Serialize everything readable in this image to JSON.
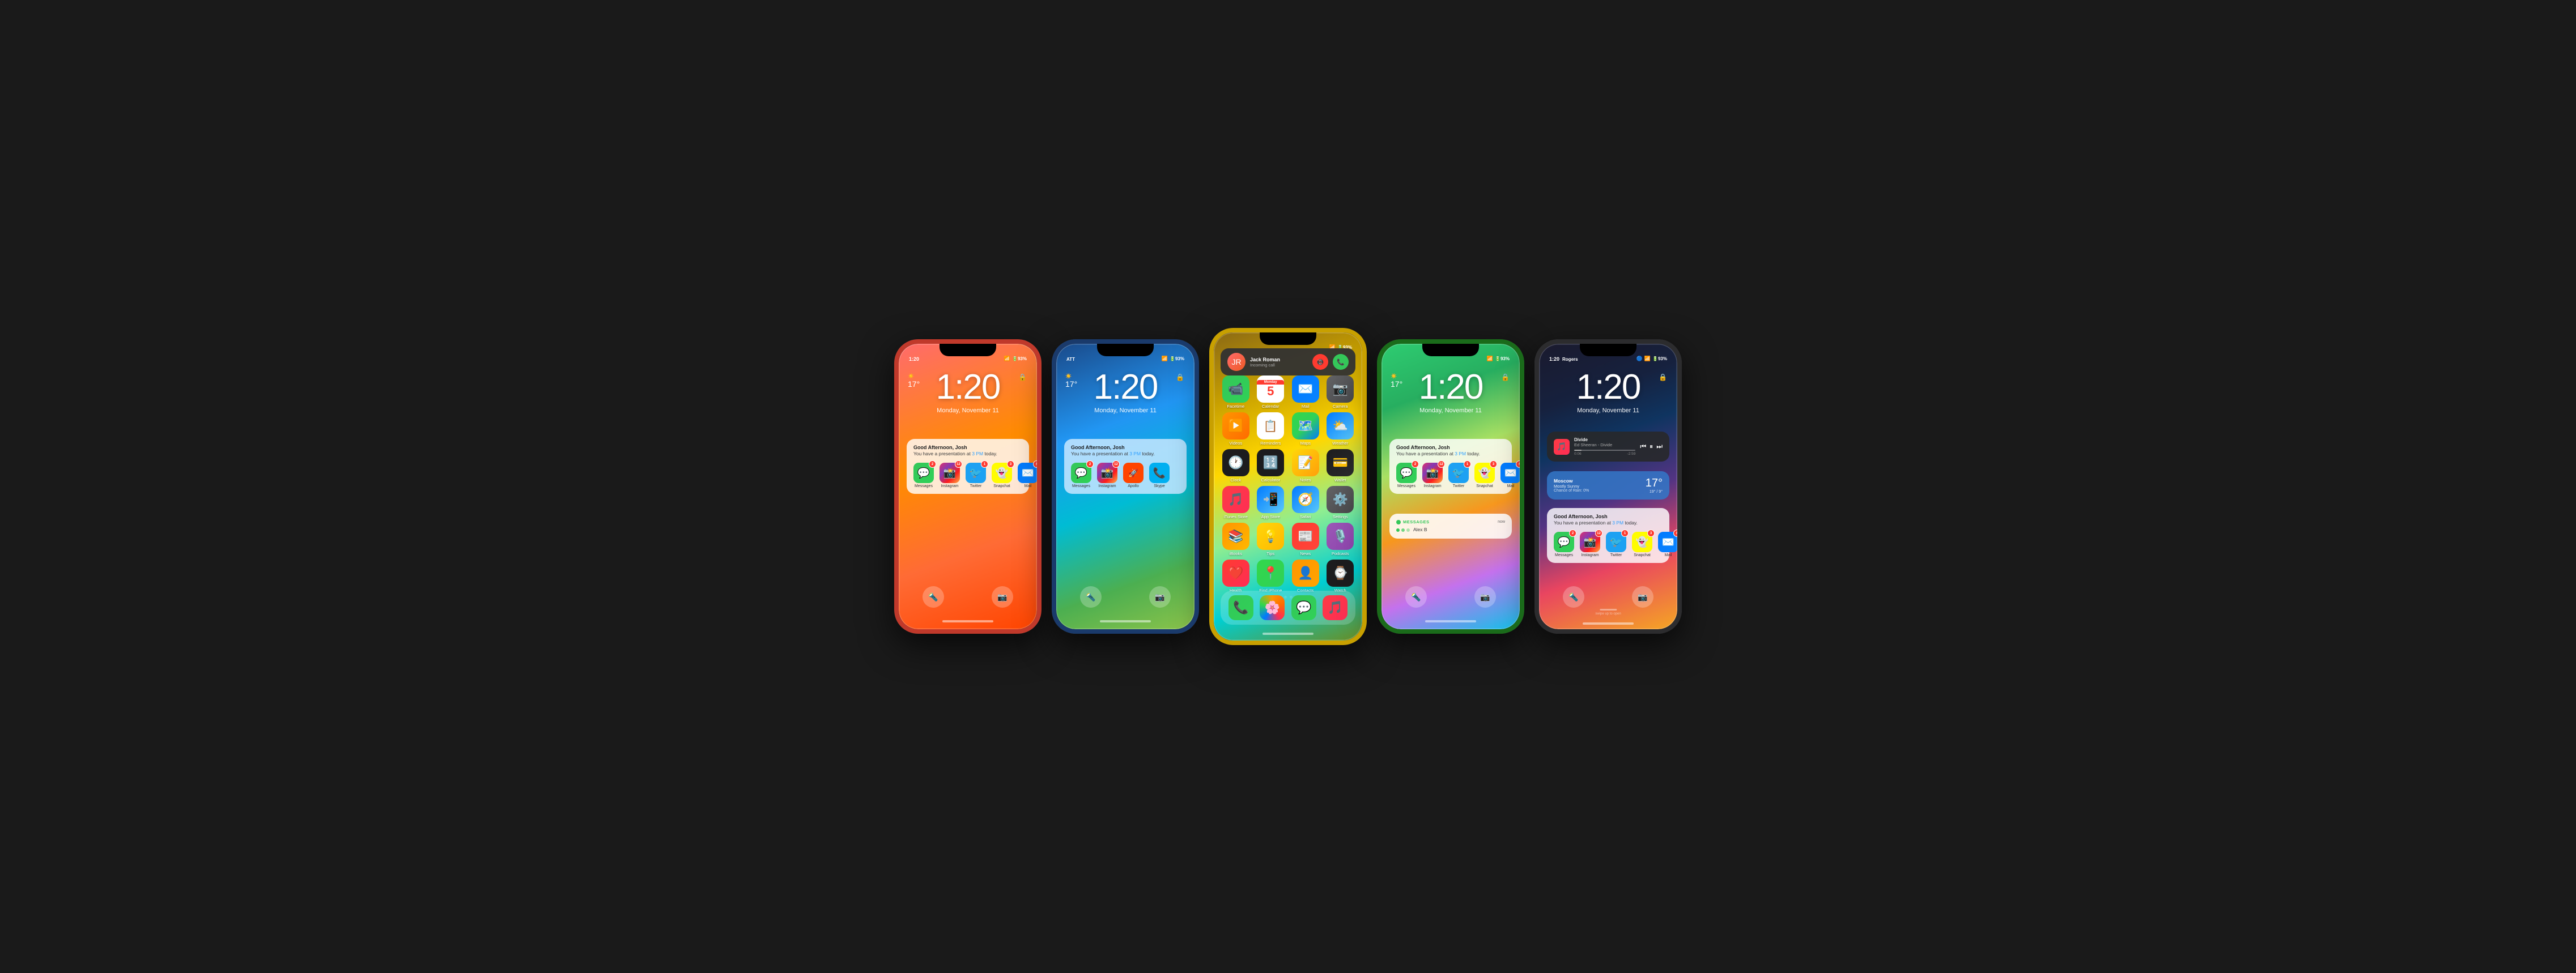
{
  "phones": [
    {
      "id": "phone-1",
      "color": "red",
      "carrier": "1:20",
      "signal": "●●●",
      "battery": "93%",
      "time": "1:20",
      "date": "Monday, November 11",
      "temp": "17°",
      "weather_icon": "☀️",
      "notif_title": "Good Afternoon, Josh",
      "notif_body": "You have a presentation at 3 PM today.",
      "apps": [
        {
          "name": "Messages",
          "icon": "💬",
          "color": "ic-messages",
          "badge": "2"
        },
        {
          "name": "Instagram",
          "icon": "📸",
          "color": "ic-instagram",
          "badge": "12"
        },
        {
          "name": "Twitter",
          "icon": "🐦",
          "color": "ic-twitter",
          "badge": "1"
        },
        {
          "name": "Snapchat",
          "icon": "👻",
          "color": "ic-snapchat",
          "badge": "3"
        },
        {
          "name": "Mail",
          "icon": "✉️",
          "color": "ic-mail",
          "badge": "4"
        }
      ]
    },
    {
      "id": "phone-2",
      "color": "blue",
      "carrier": "ATT",
      "signal": "●●●",
      "battery": "93%",
      "time": "1:20",
      "date": "Monday, November 11",
      "temp": "17°",
      "weather_icon": "☀️",
      "notif_title": "Good Afternoon, Josh",
      "notif_body": "You have a presentation at 3 PM today.",
      "apps": [
        {
          "name": "Messages",
          "icon": "💬",
          "color": "ic-messages",
          "badge": "2"
        },
        {
          "name": "Instagram",
          "icon": "📸",
          "color": "ic-instagram",
          "badge": "12"
        },
        {
          "name": "Apollo",
          "icon": "🚀",
          "color": "ic-apollo",
          "badge": ""
        },
        {
          "name": "Skype",
          "icon": "📞",
          "color": "ic-skype",
          "badge": ""
        }
      ]
    },
    {
      "id": "phone-3",
      "color": "yellow",
      "incoming_caller": "Jack Roman",
      "incoming_sub": "Incoming call",
      "home_apps_row1": [
        "Facetime",
        "Calendar",
        "Mail",
        "Camera"
      ],
      "home_apps_row2": [
        "Videos",
        "Reminders",
        "Maps",
        "Weather"
      ],
      "home_apps_row3": [
        "Clock",
        "Calculator",
        "Notes",
        "Wallet"
      ],
      "home_apps_row4": [
        "iTunes Store",
        "App Store",
        "Safari",
        "Settings"
      ],
      "home_apps_row5": [
        "iBooks",
        "Tips",
        "News",
        "Podcasts"
      ],
      "home_apps_row6": [
        "Health",
        "Find iPhone",
        "Contacts",
        "Watch"
      ],
      "dock_apps": [
        "Phone",
        "Photos",
        "Messages",
        "Music"
      ]
    },
    {
      "id": "phone-4",
      "color": "green",
      "carrier": "",
      "signal": "●●●",
      "battery": "93%",
      "time": "1:20",
      "date": "Monday, November 11",
      "temp": "17°",
      "weather_icon": "☀️",
      "notif_title": "Good Afternoon, Josh",
      "notif_body": "You have a presentation at 3 PM today.",
      "apps": [
        {
          "name": "Messages",
          "icon": "💬",
          "color": "ic-messages",
          "badge": "2"
        },
        {
          "name": "Instagram",
          "icon": "📸",
          "color": "ic-instagram",
          "badge": "12"
        },
        {
          "name": "Twitter",
          "icon": "🐦",
          "color": "ic-twitter",
          "badge": "1"
        },
        {
          "name": "Snapchat",
          "icon": "👻",
          "color": "ic-snapchat",
          "badge": "3"
        },
        {
          "name": "Mail",
          "icon": "✉️",
          "color": "ic-mail",
          "badge": "4"
        }
      ],
      "msgs_sender": "Alex B",
      "msgs_time": "now"
    },
    {
      "id": "phone-5",
      "color": "black",
      "carrier": "Rogers",
      "signal": "●●●",
      "battery": "93%",
      "time": "1:20",
      "date": "Monday, November 11",
      "music_artist": "Ed Sheeran",
      "music_song": "Divide",
      "music_album": "Divide",
      "music_time": "0:06",
      "music_total": "-2:59",
      "weather_city": "Moscow",
      "weather_desc": "Mostly Sunny",
      "weather_chance": "Chance of Rain: 0%",
      "weather_temp": "17°",
      "weather_range": "19° / 9°",
      "notif_title": "Good Afternoon, Josh",
      "notif_body": "You have a presentation at 3 PM today.",
      "apps": [
        {
          "name": "Messages",
          "icon": "💬",
          "color": "ic-messages",
          "badge": "2"
        },
        {
          "name": "Instagram",
          "icon": "📸",
          "color": "ic-instagram",
          "badge": "12"
        },
        {
          "name": "Twitter",
          "icon": "🐦",
          "color": "ic-twitter",
          "badge": "1"
        },
        {
          "name": "Snapchat",
          "icon": "👻",
          "color": "ic-snapchat",
          "badge": "3"
        },
        {
          "name": "Mail",
          "icon": "✉️",
          "color": "ic-mail",
          "badge": "4"
        }
      ]
    }
  ],
  "labels": {
    "flashlight": "🔦",
    "camera_btn": "📷",
    "lock": "🔒",
    "decline": "📵",
    "accept": "📞"
  }
}
